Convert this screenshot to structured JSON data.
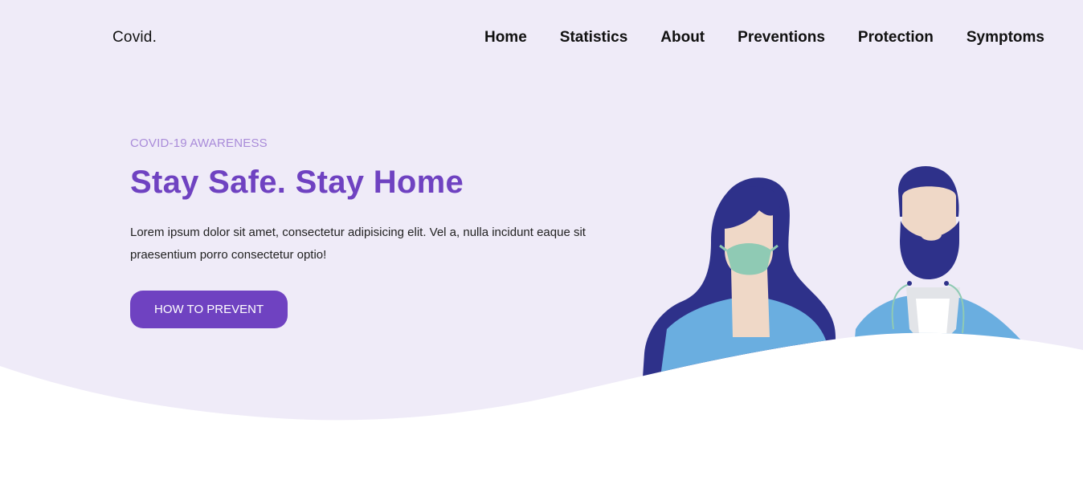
{
  "brand": {
    "logo": "Covid."
  },
  "nav": {
    "items": [
      {
        "label": "Home"
      },
      {
        "label": "Statistics"
      },
      {
        "label": "About"
      },
      {
        "label": "Preventions"
      },
      {
        "label": "Protection"
      },
      {
        "label": "Symptoms"
      }
    ]
  },
  "hero": {
    "eyebrow": "COVID-19 AWARENESS",
    "headline": "Stay Safe. Stay Home",
    "description": "Lorem ipsum dolor sit amet, consectetur adipisicing elit. Vel a, nulla incidunt eaque sit praesentium porro consectetur optio!",
    "cta_label": "HOW TO PREVENT"
  },
  "colors": {
    "hero_background": "#efebf8",
    "accent": "#6f42c1",
    "eyebrow": "#a98bd9",
    "hair": "#2e318a",
    "jacket": "#6aaee0",
    "mask": "#8fcab4",
    "skin": "#efd8c7"
  },
  "icons": {
    "illustration": "people-with-masks-illustration"
  }
}
